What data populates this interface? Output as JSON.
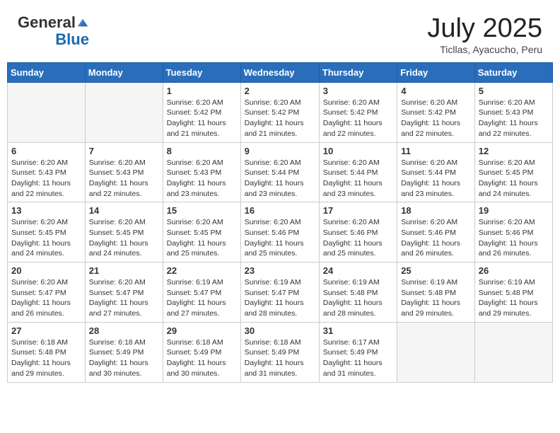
{
  "header": {
    "logo_general": "General",
    "logo_blue": "Blue",
    "month_year": "July 2025",
    "location": "Ticllas, Ayacucho, Peru"
  },
  "weekdays": [
    "Sunday",
    "Monday",
    "Tuesday",
    "Wednesday",
    "Thursday",
    "Friday",
    "Saturday"
  ],
  "weeks": [
    [
      {
        "day": "",
        "info": ""
      },
      {
        "day": "",
        "info": ""
      },
      {
        "day": "1",
        "info": "Sunrise: 6:20 AM\nSunset: 5:42 PM\nDaylight: 11 hours and 21 minutes."
      },
      {
        "day": "2",
        "info": "Sunrise: 6:20 AM\nSunset: 5:42 PM\nDaylight: 11 hours and 21 minutes."
      },
      {
        "day": "3",
        "info": "Sunrise: 6:20 AM\nSunset: 5:42 PM\nDaylight: 11 hours and 22 minutes."
      },
      {
        "day": "4",
        "info": "Sunrise: 6:20 AM\nSunset: 5:42 PM\nDaylight: 11 hours and 22 minutes."
      },
      {
        "day": "5",
        "info": "Sunrise: 6:20 AM\nSunset: 5:43 PM\nDaylight: 11 hours and 22 minutes."
      }
    ],
    [
      {
        "day": "6",
        "info": "Sunrise: 6:20 AM\nSunset: 5:43 PM\nDaylight: 11 hours and 22 minutes."
      },
      {
        "day": "7",
        "info": "Sunrise: 6:20 AM\nSunset: 5:43 PM\nDaylight: 11 hours and 22 minutes."
      },
      {
        "day": "8",
        "info": "Sunrise: 6:20 AM\nSunset: 5:43 PM\nDaylight: 11 hours and 23 minutes."
      },
      {
        "day": "9",
        "info": "Sunrise: 6:20 AM\nSunset: 5:44 PM\nDaylight: 11 hours and 23 minutes."
      },
      {
        "day": "10",
        "info": "Sunrise: 6:20 AM\nSunset: 5:44 PM\nDaylight: 11 hours and 23 minutes."
      },
      {
        "day": "11",
        "info": "Sunrise: 6:20 AM\nSunset: 5:44 PM\nDaylight: 11 hours and 23 minutes."
      },
      {
        "day": "12",
        "info": "Sunrise: 6:20 AM\nSunset: 5:45 PM\nDaylight: 11 hours and 24 minutes."
      }
    ],
    [
      {
        "day": "13",
        "info": "Sunrise: 6:20 AM\nSunset: 5:45 PM\nDaylight: 11 hours and 24 minutes."
      },
      {
        "day": "14",
        "info": "Sunrise: 6:20 AM\nSunset: 5:45 PM\nDaylight: 11 hours and 24 minutes."
      },
      {
        "day": "15",
        "info": "Sunrise: 6:20 AM\nSunset: 5:45 PM\nDaylight: 11 hours and 25 minutes."
      },
      {
        "day": "16",
        "info": "Sunrise: 6:20 AM\nSunset: 5:46 PM\nDaylight: 11 hours and 25 minutes."
      },
      {
        "day": "17",
        "info": "Sunrise: 6:20 AM\nSunset: 5:46 PM\nDaylight: 11 hours and 25 minutes."
      },
      {
        "day": "18",
        "info": "Sunrise: 6:20 AM\nSunset: 5:46 PM\nDaylight: 11 hours and 26 minutes."
      },
      {
        "day": "19",
        "info": "Sunrise: 6:20 AM\nSunset: 5:46 PM\nDaylight: 11 hours and 26 minutes."
      }
    ],
    [
      {
        "day": "20",
        "info": "Sunrise: 6:20 AM\nSunset: 5:47 PM\nDaylight: 11 hours and 26 minutes."
      },
      {
        "day": "21",
        "info": "Sunrise: 6:20 AM\nSunset: 5:47 PM\nDaylight: 11 hours and 27 minutes."
      },
      {
        "day": "22",
        "info": "Sunrise: 6:19 AM\nSunset: 5:47 PM\nDaylight: 11 hours and 27 minutes."
      },
      {
        "day": "23",
        "info": "Sunrise: 6:19 AM\nSunset: 5:47 PM\nDaylight: 11 hours and 28 minutes."
      },
      {
        "day": "24",
        "info": "Sunrise: 6:19 AM\nSunset: 5:48 PM\nDaylight: 11 hours and 28 minutes."
      },
      {
        "day": "25",
        "info": "Sunrise: 6:19 AM\nSunset: 5:48 PM\nDaylight: 11 hours and 29 minutes."
      },
      {
        "day": "26",
        "info": "Sunrise: 6:19 AM\nSunset: 5:48 PM\nDaylight: 11 hours and 29 minutes."
      }
    ],
    [
      {
        "day": "27",
        "info": "Sunrise: 6:18 AM\nSunset: 5:48 PM\nDaylight: 11 hours and 29 minutes."
      },
      {
        "day": "28",
        "info": "Sunrise: 6:18 AM\nSunset: 5:49 PM\nDaylight: 11 hours and 30 minutes."
      },
      {
        "day": "29",
        "info": "Sunrise: 6:18 AM\nSunset: 5:49 PM\nDaylight: 11 hours and 30 minutes."
      },
      {
        "day": "30",
        "info": "Sunrise: 6:18 AM\nSunset: 5:49 PM\nDaylight: 11 hours and 31 minutes."
      },
      {
        "day": "31",
        "info": "Sunrise: 6:17 AM\nSunset: 5:49 PM\nDaylight: 11 hours and 31 minutes."
      },
      {
        "day": "",
        "info": ""
      },
      {
        "day": "",
        "info": ""
      }
    ]
  ]
}
